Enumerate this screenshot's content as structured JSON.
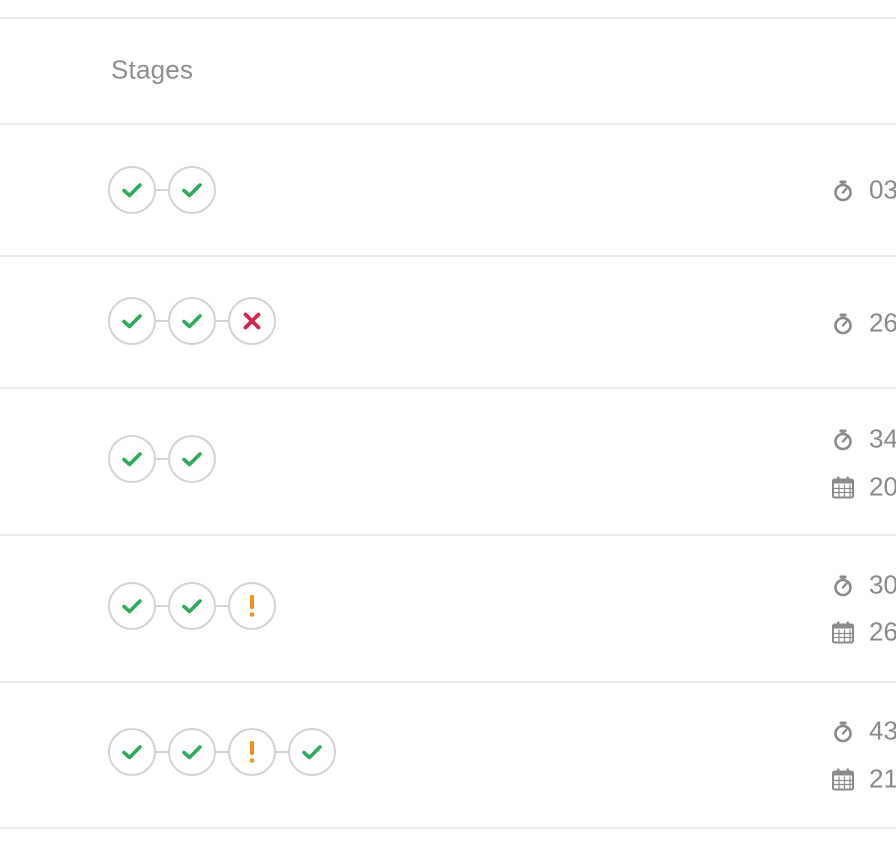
{
  "header": {
    "stages_label": "Stages"
  },
  "colors": {
    "success": "#2eaa5c",
    "failed": "#d1254d",
    "warning": "#f0901e",
    "border": "#d4d4d4",
    "divider": "#ececec",
    "muted_text": "#8a8a8a"
  },
  "rows": [
    {
      "stages": [
        "success",
        "success"
      ],
      "duration": "03",
      "date": null
    },
    {
      "stages": [
        "success",
        "success",
        "failed"
      ],
      "duration": "26",
      "date": null
    },
    {
      "stages": [
        "success",
        "success"
      ],
      "duration": "34",
      "date": "20"
    },
    {
      "stages": [
        "success",
        "success",
        "warning"
      ],
      "duration": "30",
      "date": "26"
    },
    {
      "stages": [
        "success",
        "success",
        "warning",
        "success"
      ],
      "duration": "43",
      "date": "21"
    }
  ],
  "icons": {
    "duration": "stopwatch-icon",
    "date": "calendar-icon",
    "success": "check-icon",
    "failed": "cross-icon",
    "warning": "exclamation-icon"
  }
}
